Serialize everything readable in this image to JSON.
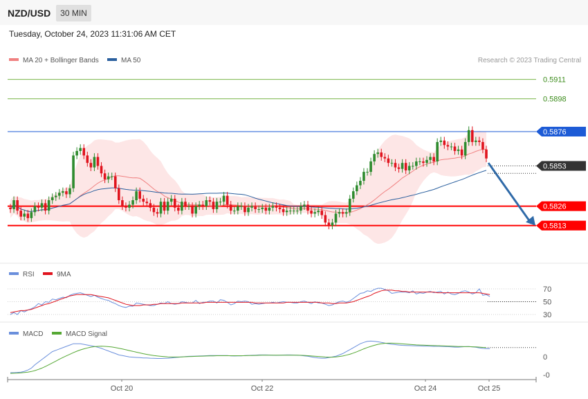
{
  "header": {
    "pair": "NZD/USD",
    "timeframe": "30 MIN",
    "datetime": "Tuesday, October 24, 2023 11:31:06 AM CET"
  },
  "colors": {
    "bull": "#2e8b2e",
    "bear": "#e0141e",
    "ma20": "#f08080",
    "ma50": "#2a5f9e",
    "band": "#fde2e2",
    "support": "#ff0000",
    "resistance_blue": "#1d5bd6",
    "target_green": "#7ab44a",
    "arrow": "#2f6aa8",
    "rsi": "#6a8fdc",
    "rsi_ma": "#e0141e",
    "macd": "#6a8fdc",
    "macd_signal": "#55a834"
  },
  "chart_data": [
    {
      "type": "line",
      "panel": "price",
      "legend": [
        {
          "name": "MA 20 + Bollinger Bands",
          "color": "#f08080"
        },
        {
          "name": "MA 50",
          "color": "#2a5f9e"
        }
      ],
      "credit": "Research © 2023 Trading Central",
      "ylim": [
        0.5804,
        0.5915
      ],
      "x_labels": [
        "Oct 20",
        "Oct 22",
        "Oct 24",
        "Oct 25"
      ],
      "levels": [
        {
          "label": "0.5911",
          "value": 0.5911,
          "kind": "target"
        },
        {
          "label": "0.5898",
          "value": 0.5898,
          "kind": "target"
        },
        {
          "label": "0.5876",
          "value": 0.5876,
          "kind": "resistance"
        },
        {
          "label": "0.5853",
          "value": 0.5853,
          "kind": "last"
        },
        {
          "label": "0.5826",
          "value": 0.5826,
          "kind": "support"
        },
        {
          "label": "0.5813",
          "value": 0.5813,
          "kind": "support"
        }
      ],
      "forecast": {
        "from": 0.5855,
        "to": 0.5813,
        "dotted_level": 0.5848
      },
      "close": [
        0.5824,
        0.583,
        0.5823,
        0.5819,
        0.5821,
        0.5818,
        0.5822,
        0.5826,
        0.5825,
        0.5828,
        0.5823,
        0.583,
        0.5832,
        0.5833,
        0.5835,
        0.5836,
        0.5834,
        0.5838,
        0.586,
        0.5863,
        0.5865,
        0.586,
        0.5855,
        0.5852,
        0.5859,
        0.5853,
        0.5848,
        0.5844,
        0.5846,
        0.5846,
        0.5838,
        0.583,
        0.5826,
        0.5825,
        0.5827,
        0.583,
        0.5836,
        0.5831,
        0.5829,
        0.5828,
        0.5825,
        0.5822,
        0.5821,
        0.5829,
        0.5823,
        0.5829,
        0.5831,
        0.5825,
        0.5823,
        0.5829,
        0.5826,
        0.5826,
        0.5821,
        0.5826,
        0.5827,
        0.5826,
        0.583,
        0.5829,
        0.5824,
        0.5829,
        0.5829,
        0.5833,
        0.5827,
        0.5823,
        0.5823,
        0.5826,
        0.5826,
        0.5822,
        0.5825,
        0.5826,
        0.5824,
        0.5824,
        0.5825,
        0.5823,
        0.5825,
        0.5826,
        0.5825,
        0.5824,
        0.5822,
        0.5823,
        0.5823,
        0.5823,
        0.5823,
        0.5826,
        0.5827,
        0.5823,
        0.5821,
        0.5822,
        0.5823,
        0.582,
        0.5815,
        0.5813,
        0.5815,
        0.5821,
        0.5822,
        0.5821,
        0.5822,
        0.5831,
        0.5836,
        0.584,
        0.5843,
        0.5849,
        0.5849,
        0.5856,
        0.5861,
        0.5862,
        0.5859,
        0.5858,
        0.5855,
        0.5855,
        0.5852,
        0.5851,
        0.5855,
        0.585,
        0.5853,
        0.5853,
        0.5856,
        0.5856,
        0.5855,
        0.5857,
        0.5859,
        0.5856,
        0.5869,
        0.587,
        0.5867,
        0.5866,
        0.5866,
        0.5863,
        0.5864,
        0.586,
        0.5869,
        0.5877,
        0.5869,
        0.587,
        0.5869,
        0.5864,
        0.5858
      ]
    },
    {
      "type": "line",
      "panel": "rsi",
      "legend": [
        {
          "name": "RSI",
          "color": "#6a8fdc"
        },
        {
          "name": "9MA",
          "color": "#e0141e"
        }
      ],
      "ylim": [
        24,
        76
      ],
      "y_ticks": [
        70,
        50,
        30
      ],
      "rsi": [
        30,
        33,
        30,
        36,
        34,
        37,
        39,
        42,
        47,
        45,
        50,
        49,
        54,
        53,
        55,
        57,
        56,
        60,
        62,
        63,
        64,
        62,
        60,
        58,
        60,
        57,
        55,
        53,
        52,
        49,
        47,
        44,
        42,
        41,
        43,
        43,
        48,
        47,
        46,
        45,
        44,
        44,
        46,
        48,
        47,
        50,
        47,
        46,
        47,
        50,
        49,
        48,
        48,
        52,
        47,
        49,
        49,
        51,
        51,
        48,
        53,
        52,
        49,
        45,
        47,
        51,
        50,
        51,
        50,
        46,
        47,
        46,
        47,
        48,
        48,
        49,
        48,
        49,
        50,
        49,
        49,
        48,
        48,
        50,
        51,
        49,
        47,
        50,
        48,
        48,
        46,
        44,
        45,
        48,
        50,
        51,
        49,
        51,
        55,
        59,
        63,
        64,
        67,
        66,
        69,
        71,
        71,
        69,
        67,
        63,
        64,
        65,
        65,
        65,
        64,
        67,
        62,
        64,
        63,
        65,
        66,
        64,
        65,
        66,
        62,
        65,
        62,
        61,
        63,
        66,
        67,
        65,
        62,
        64,
        70,
        60,
        61,
        58
      ],
      "ma9": [
        33,
        34,
        35,
        36,
        36,
        37,
        38,
        40,
        42,
        44,
        46,
        47,
        49,
        51,
        53,
        55,
        57,
        59,
        60,
        61,
        61,
        61,
        61,
        61,
        60,
        59,
        58,
        57,
        56,
        54,
        52,
        50,
        48,
        46,
        45,
        44,
        44,
        44,
        45,
        45,
        45,
        46,
        46,
        47,
        47,
        47,
        47,
        47,
        47,
        48,
        48,
        48,
        48,
        48,
        48,
        48,
        49,
        49,
        49,
        49,
        49,
        49,
        49,
        49,
        49,
        49,
        49,
        49,
        49,
        49,
        48,
        48,
        48,
        48,
        48,
        48,
        48,
        48,
        48,
        49,
        49,
        49,
        49,
        49,
        49,
        49,
        49,
        49,
        49,
        48,
        48,
        48,
        47,
        47,
        48,
        48,
        48,
        49,
        50,
        52,
        54,
        56,
        58,
        60,
        63,
        65,
        67,
        68,
        68,
        68,
        67,
        67,
        66,
        66,
        65,
        65,
        65,
        65,
        65,
        65,
        65,
        65,
        64,
        64,
        64,
        64,
        64,
        64,
        64,
        64,
        64,
        64,
        64,
        64,
        64,
        63,
        62,
        61
      ],
      "rsi_dotted_level": 50
    },
    {
      "type": "line",
      "panel": "macd",
      "legend": [
        {
          "name": "MACD",
          "color": "#6a8fdc"
        },
        {
          "name": "MACD Signal",
          "color": "#55a834"
        }
      ],
      "ylim": [
        -12,
        14
      ],
      "y_ticks": [
        {
          "label": "0",
          "value": 0
        },
        {
          "label": "-0",
          "value": -0.0001
        }
      ],
      "macd": [
        -10,
        -10,
        -9.8,
        -9.6,
        -9,
        -8,
        -6.5,
        -4,
        -2,
        0,
        2,
        4,
        6,
        7,
        8,
        9,
        10,
        11,
        12,
        12,
        12,
        11.5,
        11,
        10.5,
        10,
        9.3,
        8.5,
        7.5,
        6.5,
        5.5,
        4.5,
        3.5,
        3,
        2.5,
        2,
        1.8,
        1.6,
        1.4,
        1.2,
        1.2,
        1,
        0.9,
        0.8,
        0.8,
        0.9,
        1,
        1.2,
        1.5,
        1.7,
        2,
        2.2,
        2.4,
        2.5,
        2.6,
        2.7,
        2.8,
        2.9,
        3,
        3,
        3,
        3,
        3,
        3,
        2.8,
        2.7,
        2.8,
        2.8,
        3,
        3.1,
        3.2,
        3.3,
        3.5,
        3.5,
        3.5,
        3.4,
        3.3,
        3.2,
        3.3,
        3.4,
        3.5,
        3.5,
        3.4,
        3.3,
        3.1,
        2.8,
        2.5,
        2,
        1.5,
        1.2,
        1,
        1,
        1.5,
        2,
        2.5,
        3.5,
        4.5,
        6,
        7.5,
        9,
        10.5,
        12,
        13,
        13.8,
        14,
        13.8,
        13.5,
        13,
        12.5,
        12,
        11.6,
        11.3,
        11,
        10.8,
        10.7,
        10.6,
        10.5,
        10.4,
        10.3,
        10.2,
        10.2,
        10.1,
        10,
        10.1,
        10,
        9.9,
        9.8,
        9.6,
        9.4,
        9.4,
        9.6,
        9.8,
        9.9,
        9.6,
        9.3,
        8.8,
        8.5,
        8.3,
        8.2
      ],
      "signal": [
        -10.5,
        -10.4,
        -10.3,
        -10.1,
        -9.9,
        -9.6,
        -9.1,
        -8.4,
        -7.5,
        -6.5,
        -5.3,
        -4,
        -2.6,
        -1.2,
        0.2,
        1.5,
        2.8,
        4,
        5.2,
        6.3,
        7.3,
        8.1,
        8.8,
        9.4,
        9.8,
        10,
        10.1,
        10,
        9.8,
        9.5,
        9.1,
        8.6,
        8,
        7.4,
        6.8,
        6.2,
        5.6,
        5,
        4.4,
        3.9,
        3.4,
        3,
        2.7,
        2.4,
        2.2,
        2,
        1.9,
        1.9,
        1.9,
        2,
        2.1,
        2.2,
        2.3,
        2.4,
        2.5,
        2.6,
        2.7,
        2.8,
        2.8,
        2.9,
        2.9,
        2.9,
        2.9,
        2.9,
        2.9,
        2.9,
        2.9,
        2.9,
        3,
        3,
        3.1,
        3.2,
        3.3,
        3.3,
        3.3,
        3.3,
        3.3,
        3.3,
        3.3,
        3.3,
        3.3,
        3.3,
        3.3,
        3.2,
        3.1,
        2.9,
        2.7,
        2.5,
        2.3,
        2.1,
        1.9,
        1.8,
        1.8,
        2,
        2.3,
        2.7,
        3.3,
        4,
        4.9,
        5.9,
        7,
        8.1,
        9.1,
        10,
        10.8,
        11.5,
        12,
        12.3,
        12.4,
        12.4,
        12.3,
        12.1,
        11.9,
        11.7,
        11.5,
        11.3,
        11.1,
        11,
        10.9,
        10.8,
        10.7,
        10.6,
        10.5,
        10.4,
        10.3,
        10.2,
        10.1,
        10,
        9.9,
        9.9,
        9.8,
        9.8,
        9.7,
        9.6,
        9.4,
        9.2,
        9.1
      ]
    }
  ]
}
